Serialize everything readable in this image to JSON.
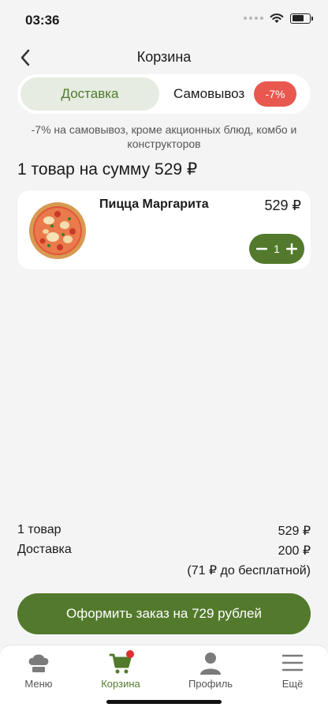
{
  "status": {
    "time": "03:36"
  },
  "header": {
    "title": "Корзина"
  },
  "segment": {
    "delivery": "Доставка",
    "pickup": "Самовывоз",
    "discount": "-7%"
  },
  "promo_note": "-7% на самовывоз, кроме акционных блюд, комбо и конструкторов",
  "cart": {
    "summary": "1 товар на сумму 529 ₽",
    "items": [
      {
        "name": "Пицца Маргарита",
        "price": "529 ₽",
        "qty": "1"
      }
    ]
  },
  "totals": {
    "items_label": "1 товар",
    "items_value": "529 ₽",
    "delivery_label": "Доставка",
    "delivery_value": "200 ₽",
    "free_hint": "(71 ₽ до бесплатной)"
  },
  "checkout": {
    "label": "Оформить заказ на 729 рублей"
  },
  "tabs": [
    {
      "label": "Меню",
      "icon": "chef-hat-icon"
    },
    {
      "label": "Корзина",
      "icon": "cart-icon"
    },
    {
      "label": "Профиль",
      "icon": "user-icon"
    },
    {
      "label": "Ещё",
      "icon": "menu-icon"
    }
  ],
  "colors": {
    "accent": "#537a2c",
    "discount": "#e8584f",
    "badge": "#e02e2e"
  }
}
